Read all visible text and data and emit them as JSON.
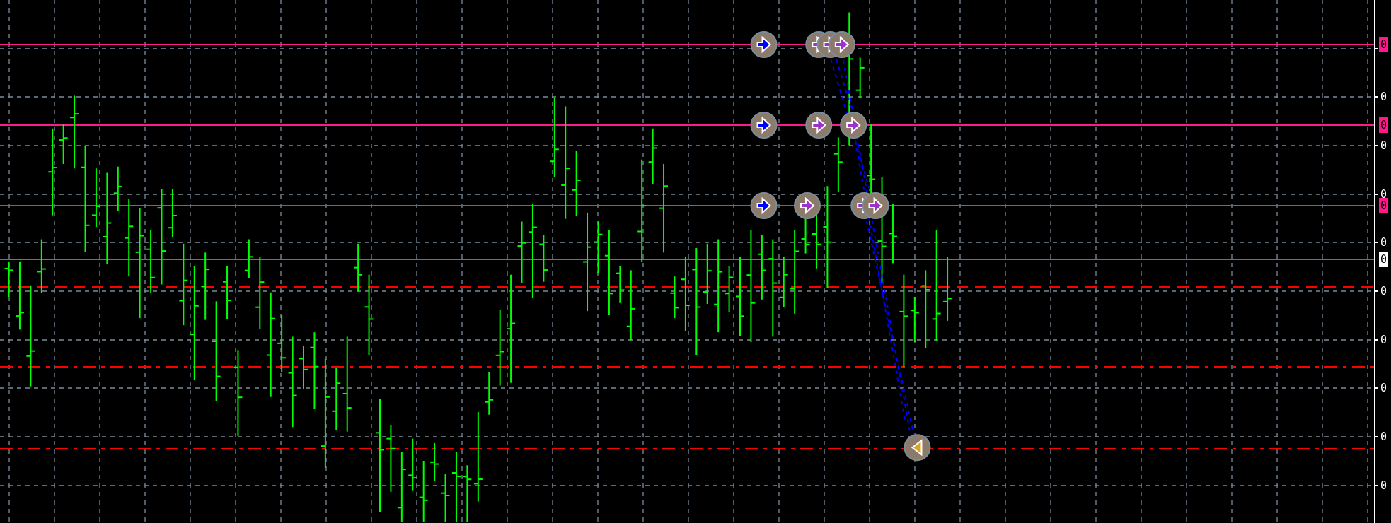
{
  "price_axis": {
    "labels": [
      {
        "text": "0",
        "kind": "level"
      },
      {
        "text": "0",
        "kind": "grid"
      },
      {
        "text": "0",
        "kind": "level"
      },
      {
        "text": "0",
        "kind": "grid"
      },
      {
        "text": "0",
        "kind": "grid"
      },
      {
        "text": "0",
        "kind": "level"
      },
      {
        "text": "0",
        "kind": "grid"
      },
      {
        "text": "0",
        "kind": "price"
      },
      {
        "text": "0",
        "kind": "grid"
      },
      {
        "text": "0",
        "kind": "grid"
      },
      {
        "text": "0",
        "kind": "grid"
      },
      {
        "text": "0",
        "kind": "grid"
      },
      {
        "text": "0",
        "kind": "grid"
      }
    ]
  }
}
